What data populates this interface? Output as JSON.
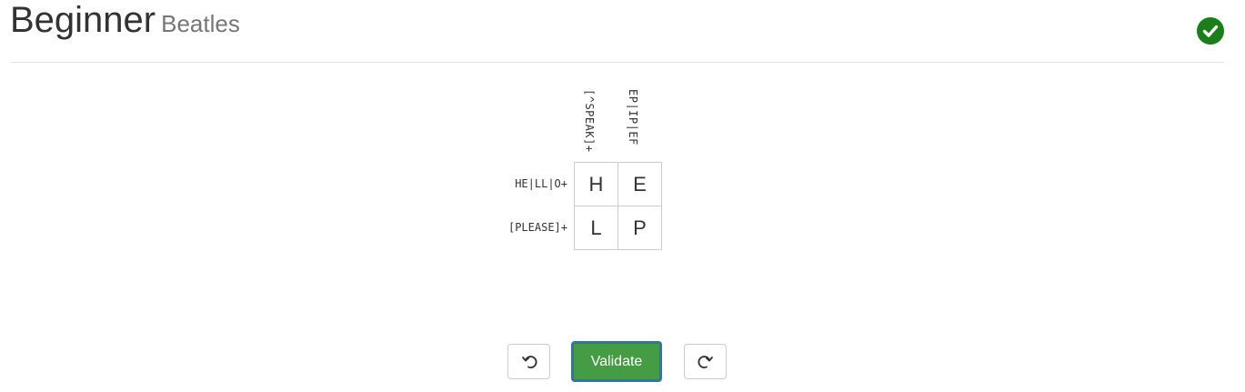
{
  "header": {
    "title": "Beginner",
    "subtitle": "Beatles",
    "status_icon": "check-circle-icon",
    "status_color": "#1a7f1a"
  },
  "puzzle": {
    "column_clues": [
      "[^SPEAK]+",
      "EP|IP|EF"
    ],
    "row_clues": [
      "HE|LL|O+",
      "[PLEASE]+"
    ],
    "cells": [
      [
        "H",
        "E"
      ],
      [
        "L",
        "P"
      ]
    ]
  },
  "controls": {
    "undo_icon": "undo-icon",
    "validate_label": "Validate",
    "redo_icon": "redo-icon",
    "validate_color": "#449d44"
  }
}
